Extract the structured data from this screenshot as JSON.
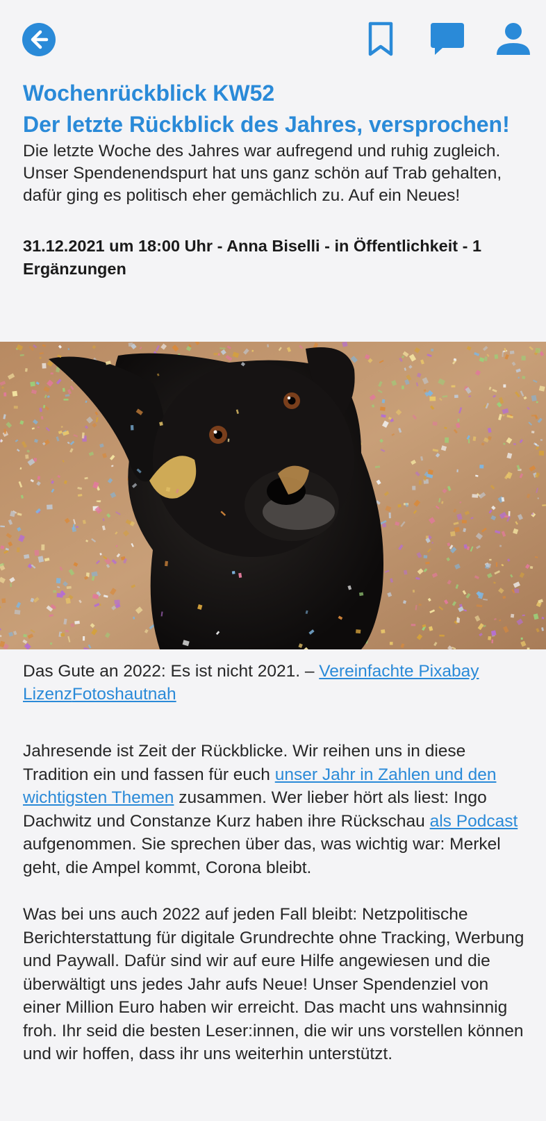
{
  "colors": {
    "accent": "#2a8ad8",
    "background": "#f4f4f6",
    "text": "#262626"
  },
  "toolbar": {
    "back_icon": "arrow-left-circle-icon",
    "bookmark_icon": "bookmark-icon",
    "comments_icon": "chat-bubble-icon",
    "account_icon": "person-icon"
  },
  "article": {
    "kicker": "Wochenrückblick KW52",
    "title": "Der letzte Rückblick des Jahres, versprochen!",
    "lead": "Die letzte Woche des Jahres war aufregend und ruhig zugleich. Unser Spendenendspurt hat uns ganz schön auf Trab gehalten, dafür ging es politisch eher gemächlich zu. Auf ein Neues!",
    "meta": {
      "date": "31.12.2021",
      "time_sep": "um",
      "time": "18:00 Uhr",
      "sep1": "-",
      "author": "Anna Biselli",
      "sep2": "-",
      "in_label": "in",
      "category": "Öffentlichkeit",
      "sep3": "-",
      "comments_count": "1",
      "comments_label": "Ergänzungen"
    },
    "image": {
      "subject": "black dog surrounded by falling confetti"
    },
    "caption": {
      "text": "Das Gute an 2022: Es ist nicht 2021. – ",
      "license_link": "Vereinfachte Pixabay Lizenz",
      "photographer_link": "Fotoshautnah"
    },
    "body": {
      "p1_a": "Jahresende ist Zeit der Rückblicke. Wir reihen uns in diese Tradition ein und fassen für euch ",
      "p1_link1": "unser Jahr in Zahlen und den wichtigsten Themen",
      "p1_b": " zusammen. Wer lieber hört als liest: Ingo Dachwitz und Constanze Kurz haben ihre Rückschau ",
      "p1_link2": "als Podcast",
      "p1_c": " aufgenommen. Sie sprechen über das, was wichtig war: Merkel geht, die Ampel kommt, Corona bleibt.",
      "p2": "Was bei uns auch 2022 auf jeden Fall bleibt: Netzpolitische Berichterstattung für digitale Grundrechte ohne Tracking, Werbung und Paywall. Dafür sind wir auf eure Hilfe angewiesen und die überwältigt uns jedes Jahr aufs Neue! Unser Spendenziel von einer Million Euro haben wir erreicht. Das macht uns wahnsinnig froh. Ihr seid die besten Leser:innen, die wir uns vorstellen können und wir hoffen, dass ihr uns weiterhin unterstützt."
    }
  }
}
